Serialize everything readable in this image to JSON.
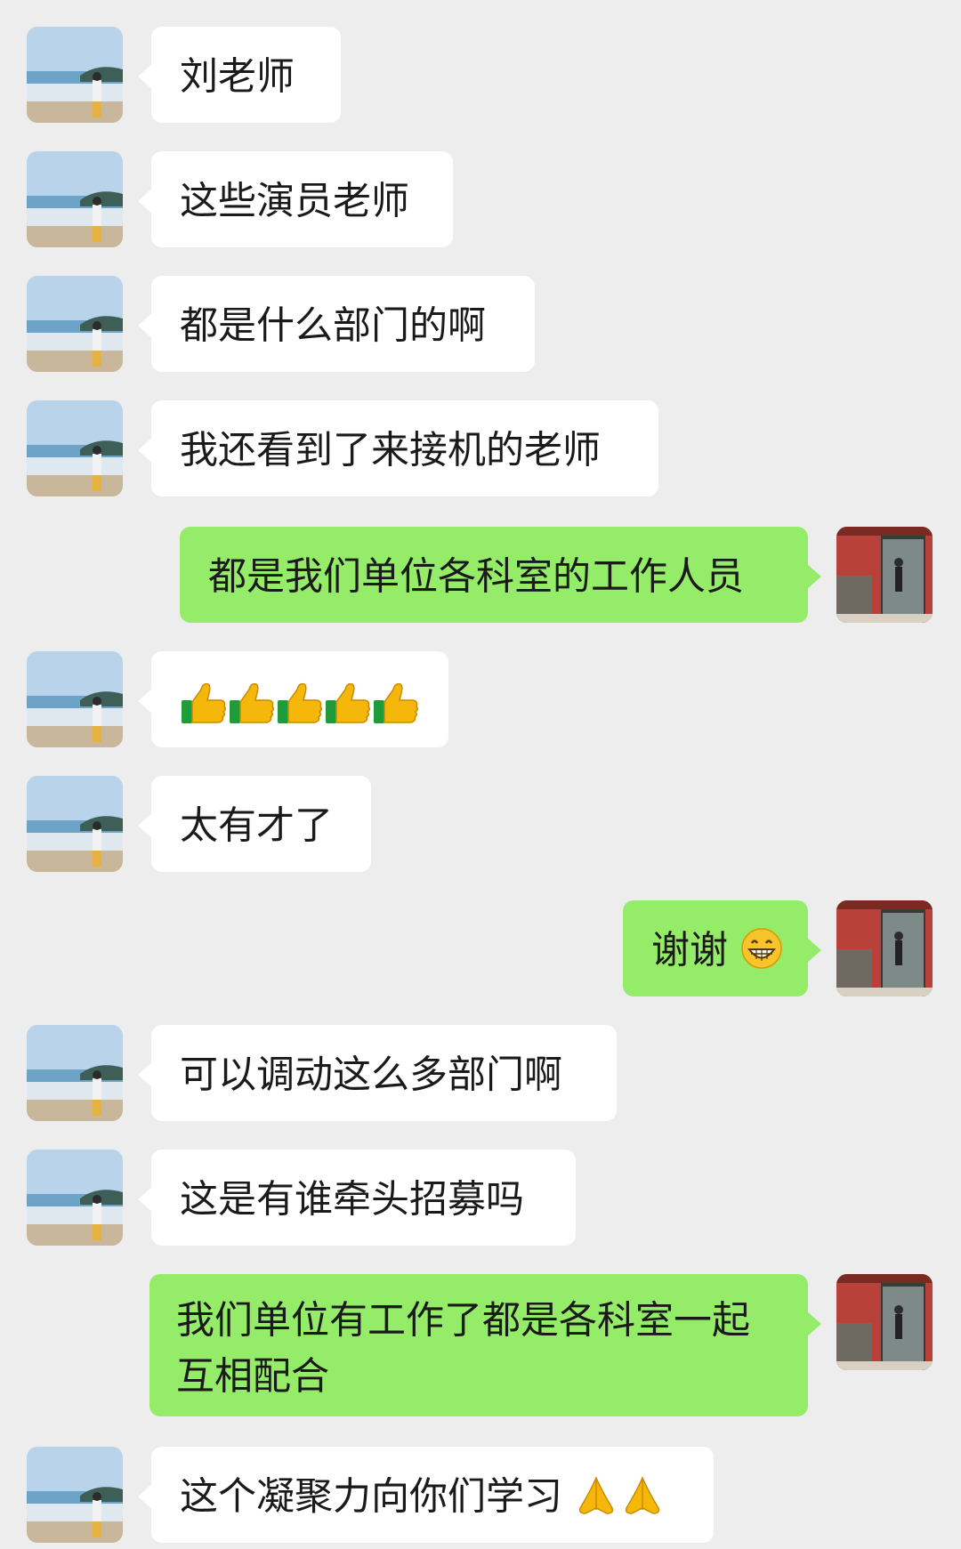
{
  "messages": [
    {
      "side": "left",
      "text": "刘老师"
    },
    {
      "side": "left",
      "text": "这些演员老师"
    },
    {
      "side": "left",
      "text": "都是什么部门的啊"
    },
    {
      "side": "left",
      "text": "我还看到了来接机的老师"
    },
    {
      "side": "right",
      "text": "都是我们单位各科室的工作人员"
    },
    {
      "side": "left",
      "text": "",
      "emoji": "thumbs-up-icon",
      "emoji_count": 5
    },
    {
      "side": "left",
      "text": "太有才了"
    },
    {
      "side": "right",
      "text": "谢谢",
      "emoji": "grinning-face-icon",
      "emoji_count": 1
    },
    {
      "side": "left",
      "text": "可以调动这么多部门啊"
    },
    {
      "side": "left",
      "text": "这是有谁牵头招募吗"
    },
    {
      "side": "right",
      "text": "我们单位有工作了都是各科室一起互相配合"
    },
    {
      "side": "left",
      "text": "这个凝聚力向你们学习",
      "emoji": "folded-hands-icon",
      "emoji_count": 2
    }
  ],
  "colors": {
    "background": "#ededed",
    "incoming_bubble": "#ffffff",
    "outgoing_bubble": "#95ec69",
    "text": "#1a1a1a"
  },
  "avatars": {
    "incoming": "beach-photo-avatar",
    "outgoing": "red-wall-photo-avatar"
  }
}
